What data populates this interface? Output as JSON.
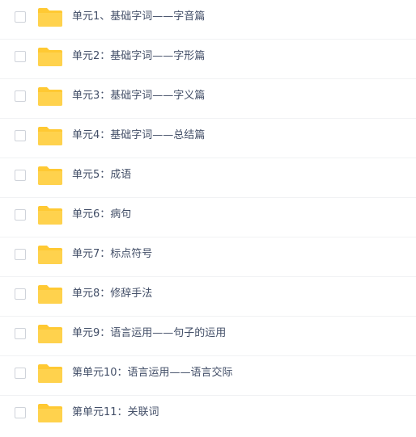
{
  "folder_color": "#FFC933",
  "folder_icon": "folder-icon",
  "items": [
    {
      "name": "单元1、基础字词——字音篇"
    },
    {
      "name": "单元2：基础字词——字形篇"
    },
    {
      "name": "单元3：基础字词——字义篇"
    },
    {
      "name": "单元4：基础字词——总结篇"
    },
    {
      "name": "单元5：成语"
    },
    {
      "name": "单元6：病句"
    },
    {
      "name": "单元7：标点符号"
    },
    {
      "name": "单元8：修辞手法"
    },
    {
      "name": "单元9：语言运用——句子的运用"
    },
    {
      "name": "第单元10：语言运用——语言交际"
    },
    {
      "name": "第单元11：关联词"
    }
  ]
}
